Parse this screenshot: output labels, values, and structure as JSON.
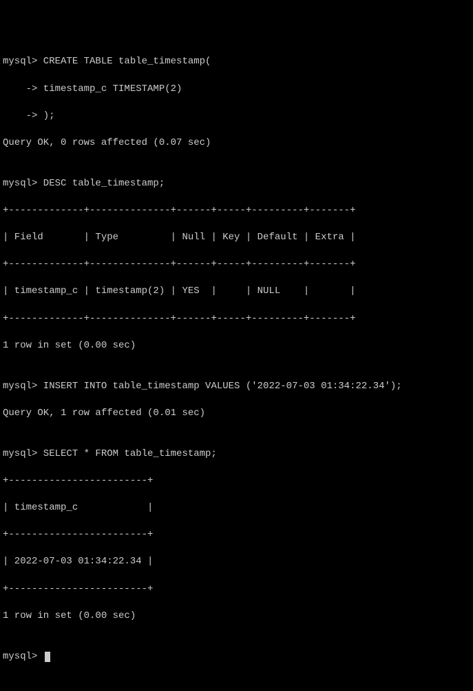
{
  "lines": {
    "l01": "mysql> CREATE TABLE table_timestamp(",
    "l02": "    -> timestamp_c TIMESTAMP(2)",
    "l03": "    -> );",
    "l04": "Query OK, 0 rows affected (0.07 sec)",
    "l05": "",
    "l06": "mysql> DESC table_timestamp;",
    "l07": "+-------------+--------------+------+-----+---------+-------+",
    "l08": "| Field       | Type         | Null | Key | Default | Extra |",
    "l09": "+-------------+--------------+------+-----+---------+-------+",
    "l10": "| timestamp_c | timestamp(2) | YES  |     | NULL    |       |",
    "l11": "+-------------+--------------+------+-----+---------+-------+",
    "l12": "1 row in set (0.00 sec)",
    "l13": "",
    "l14": "mysql> INSERT INTO table_timestamp VALUES ('2022-07-03 01:34:22.34');",
    "l15": "Query OK, 1 row affected (0.01 sec)",
    "l16": "",
    "l17": "mysql> SELECT * FROM table_timestamp;",
    "l18": "+------------------------+",
    "l19": "| timestamp_c            |",
    "l20": "+------------------------+",
    "l21": "| 2022-07-03 01:34:22.34 |",
    "l22": "+------------------------+",
    "l23": "1 row in set (0.00 sec)",
    "l24": "",
    "l25": "mysql> "
  }
}
